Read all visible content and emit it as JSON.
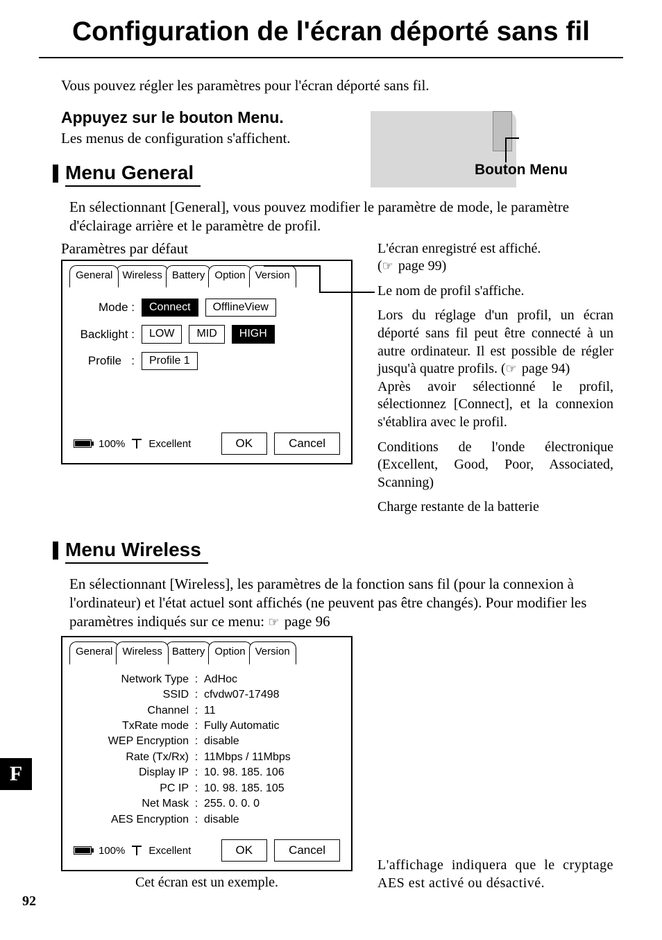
{
  "title": "Configuration de l'écran déporté sans fil",
  "intro": "Vous pouvez régler les paramètres pour l'écran déporté sans fil.",
  "step_head": "Appuyez sur le bouton Menu.",
  "step_text": "Les menus de configuration s'affichent.",
  "button_menu_label": "Bouton Menu",
  "general": {
    "head": "Menu General",
    "para": "En sélectionnant [General], vous pouvez modifier le paramètre de mode, le paramètre d'éclairage arrière et le paramètre de profil.",
    "defaults_label": "Paramètres par défaut"
  },
  "panel_tabs": {
    "general": "General",
    "wireless": "Wireless",
    "battery": "Battery",
    "option": "Option",
    "version": "Version"
  },
  "general_panel": {
    "mode_label": "Mode",
    "connect": "Connect",
    "offline": "OfflineView",
    "backlight_label": "Backlight",
    "low": "LOW",
    "mid": "MID",
    "high": "HIGH",
    "profile_label": "Profile",
    "profile_value": "Profile 1",
    "battery_pct": "100%",
    "signal": "Excellent",
    "ok": "OK",
    "cancel": "Cancel"
  },
  "callouts": {
    "c1": "L'écran enregistré est affiché.",
    "c1_ref": "page 99)",
    "c2": "Le nom de profil s'affiche.",
    "c3a": "Lors du réglage d'un profil, un écran déporté sans fil peut être connecté à un autre ordinateur. Il est possible de régler jusqu'à quatre profils. (",
    "c3b": "page 94)",
    "c3c": "Après avoir sélectionné le profil, sélectionnez [Connect], et la connexion s'établira avec le profil.",
    "c4": "Conditions de l'onde électronique (Excellent, Good, Poor, Associated, Scanning)",
    "c5": "Charge restante de la batterie"
  },
  "wireless": {
    "head": "Menu Wireless",
    "para": "En sélectionnant [Wireless], les paramètres de la fonction sans fil (pour la connexion à l'ordinateur) et l'état actuel sont affichés (ne peuvent pas être changés). Pour modifier les paramètres indiqués sur ce menu: ",
    "ref": "page 96"
  },
  "wireless_panel": {
    "rows": [
      {
        "k": "Network Type",
        "v": "AdHoc"
      },
      {
        "k": "SSID",
        "v": "cfvdw07-17498"
      },
      {
        "k": "Channel",
        "v": "11"
      },
      {
        "k": "TxRate mode",
        "v": "Fully Automatic"
      },
      {
        "k": "WEP Encryption",
        "v": "disable"
      },
      {
        "k": "Rate (Tx/Rx)",
        "v": "11Mbps / 11Mbps"
      },
      {
        "k": "Display IP",
        "v": "  10.  98. 185. 106"
      },
      {
        "k": "PC IP",
        "v": "  10.  98. 185. 105"
      },
      {
        "k": "Net Mask",
        "v": "255.    0.    0.    0"
      },
      {
        "k": "AES Encryption",
        "v": "disable"
      }
    ],
    "battery_pct": "100%",
    "signal": "Excellent",
    "ok": "OK",
    "cancel": "Cancel"
  },
  "aes_note": "L'affichage indiquera que le cryptage AES est activé ou désactivé.",
  "caption": "Cet écran est un exemple.",
  "side_tab": "F",
  "page_num": "92"
}
